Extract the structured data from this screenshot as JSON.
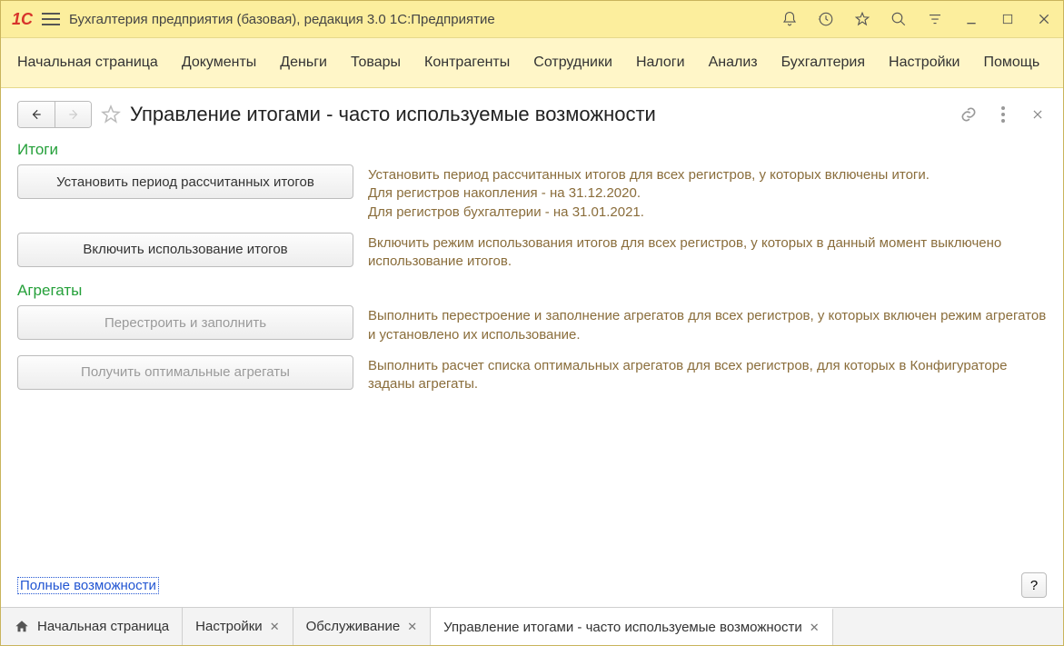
{
  "titlebar": {
    "app_title": "Бухгалтерия предприятия (базовая), редакция 3.0 1С:Предприятие"
  },
  "nav": {
    "items": [
      "Начальная страница",
      "Документы",
      "Деньги",
      "Товары",
      "Контрагенты",
      "Сотрудники",
      "Налоги",
      "Анализ",
      "Бухгалтерия",
      "Настройки",
      "Помощь"
    ]
  },
  "page": {
    "title": "Управление итогами - часто используемые возможности"
  },
  "sections": {
    "totals": {
      "title": "Итоги",
      "rows": [
        {
          "button": "Установить период рассчитанных итогов",
          "disabled": false,
          "desc": "Установить период рассчитанных итогов для всех регистров, у которых включены итоги.\nДля регистров накопления - на 31.12.2020.\nДля регистров бухгалтерии - на 31.01.2021."
        },
        {
          "button": "Включить использование итогов",
          "disabled": false,
          "desc": "Включить режим использования итогов для всех регистров, у которых в данный момент выключено использование итогов."
        }
      ]
    },
    "aggregates": {
      "title": "Агрегаты",
      "rows": [
        {
          "button": "Перестроить и заполнить",
          "disabled": true,
          "desc": "Выполнить перестроение и заполнение агрегатов для всех регистров, у которых включен режим агрегатов и установлено их использование."
        },
        {
          "button": "Получить оптимальные агрегаты",
          "disabled": true,
          "desc": "Выполнить расчет списка оптимальных агрегатов для всех регистров, для которых в Конфигураторе заданы агрегаты."
        }
      ]
    }
  },
  "bottom": {
    "full_link": "Полные возможности",
    "help": "?"
  },
  "tabs": [
    {
      "label": "Начальная страница",
      "closable": false,
      "home": true,
      "active": false
    },
    {
      "label": "Настройки",
      "closable": true,
      "home": false,
      "active": false
    },
    {
      "label": "Обслуживание",
      "closable": true,
      "home": false,
      "active": false
    },
    {
      "label": "Управление итогами - часто используемые возможности",
      "closable": true,
      "home": false,
      "active": true
    }
  ]
}
